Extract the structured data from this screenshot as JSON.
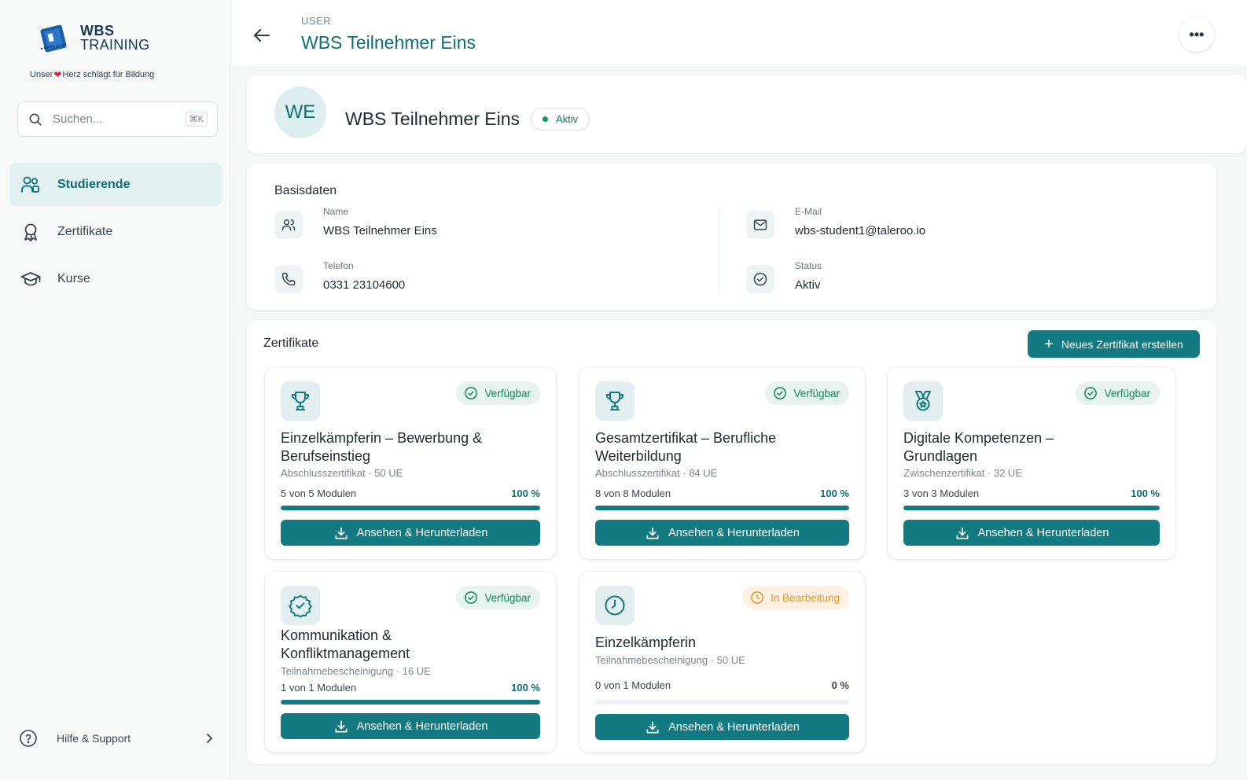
{
  "brand": {
    "line1": "WBS",
    "line2": "TRAINING",
    "tagline_before": "Unser",
    "tagline_after": "Herz schlägt für Bildung",
    "color": "#163a55"
  },
  "search": {
    "placeholder": "Suchen...",
    "shortcut": "⌘K"
  },
  "nav": [
    {
      "label": "Studierende",
      "icon": "users-icon",
      "active": true
    },
    {
      "label": "Zertifikate",
      "icon": "award-icon",
      "active": false
    },
    {
      "label": "Kurse",
      "icon": "graduation-cap-icon",
      "active": false
    }
  ],
  "help": {
    "label": "Hilfe & Support"
  },
  "header": {
    "breadcrumb": "USER",
    "title": "WBS Teilnehmer Eins",
    "more": "•••"
  },
  "profile": {
    "initials": "WE",
    "name": "WBS Teilnehmer Eins",
    "status": "Aktiv"
  },
  "basisdaten": {
    "title": "Basisdaten",
    "fields": [
      {
        "label": "Name",
        "value": "WBS Teilnehmer Eins",
        "icon": "user-icon"
      },
      {
        "label": "E-Mail",
        "value": "wbs-student1@taleroo.io",
        "icon": "mail-icon"
      },
      {
        "label": "Telefon",
        "value": "0331 23104600",
        "icon": "phone-icon"
      },
      {
        "label": "Status",
        "value": "Aktiv",
        "icon": "check-circle-icon"
      }
    ]
  },
  "zertifikate": {
    "title": "Zertifikate",
    "new_button": "Neues Zertifikat erstellen",
    "cards": [
      {
        "icon": "trophy-icon",
        "status": "Verfügbar",
        "title_l1": "Einzelkämpferin – Bewerbung &",
        "title_l2": "Berufseinstieg",
        "meta": "Abschlusszertifikat · 50 UE",
        "progress_label": "5 von 5 Modulen",
        "percent_label": "100 %",
        "progress": 1.0,
        "button": "Ansehen & Herunterladen"
      },
      {
        "icon": "trophy-icon",
        "status": "Verfügbar",
        "title_l1": "Gesamtzertifikat – Berufliche",
        "title_l2": "Weiterbildung",
        "meta": "Abschlusszertifikat · 84 UE",
        "progress_label": "8 von 8 Modulen",
        "percent_label": "100 %",
        "progress": 1.0,
        "button": "Ansehen & Herunterladen"
      },
      {
        "icon": "medal-icon",
        "status": "Verfügbar",
        "title_l1": "Digitale Kompetenzen –",
        "title_l2": "Grundlagen",
        "meta": "Zwischenzertifikat · 32 UE",
        "progress_label": "3 von 3 Modulen",
        "percent_label": "100 %",
        "progress": 1.0,
        "button": "Ansehen & Herunterladen"
      },
      {
        "icon": "badge-check-icon",
        "status": "Verfügbar",
        "title_l1": "Kommunikation &",
        "title_l2": "Konfliktmanagement",
        "meta": "Teilnahmebescheinigung · 16 UE",
        "progress_label": "1 von 1 Modulen",
        "percent_label": "100 %",
        "progress": 1.0,
        "button": "Ansehen & Herunterladen"
      },
      {
        "icon": "clock-icon",
        "status": "In Bearbeitung",
        "title_l1": "Einzelkämpferin",
        "title_l2": "",
        "meta": "Teilnahmebescheinigung · 50 UE",
        "progress_label": "0 von 1 Modulen",
        "percent_label": "0 %",
        "progress": 0.0,
        "button": "Ansehen & Herunterladen"
      }
    ]
  },
  "colors": {
    "accent": "#127a80",
    "accent_text": "#0d6e75",
    "available": "#11865a",
    "in_progress": "#e8962b",
    "heart": "#d7263d"
  }
}
